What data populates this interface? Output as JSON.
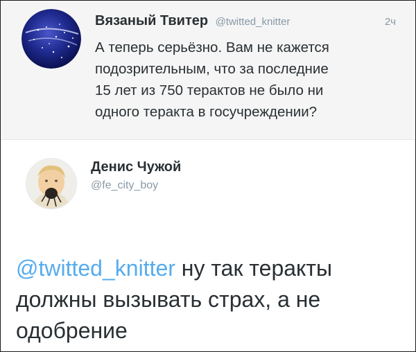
{
  "tweet": {
    "author_name": "Вязаный Твитер",
    "author_handle": "@twitted_knitter",
    "timestamp": "2ч",
    "text_lines": [
      "А теперь серьёзно. Вам не кажется",
      "подозрительным, что за последние",
      "15 лет из 750 терактов не было ни",
      "одного теракта в госучреждении?"
    ]
  },
  "reply": {
    "author_name": "Денис Чужой",
    "author_handle": "@fe_city_boy",
    "mention": "@twitted_knitter",
    "text_after_mention": " ну так теракты должны вызывать страх, а не одобрение"
  },
  "colors": {
    "link": "#55acee",
    "muted": "#8899a6",
    "text": "#292f33",
    "top_background": "#f5f5f5"
  },
  "icons": {
    "top_avatar": "globe-avatar-icon",
    "reply_avatar": "child-photo-avatar-icon"
  }
}
